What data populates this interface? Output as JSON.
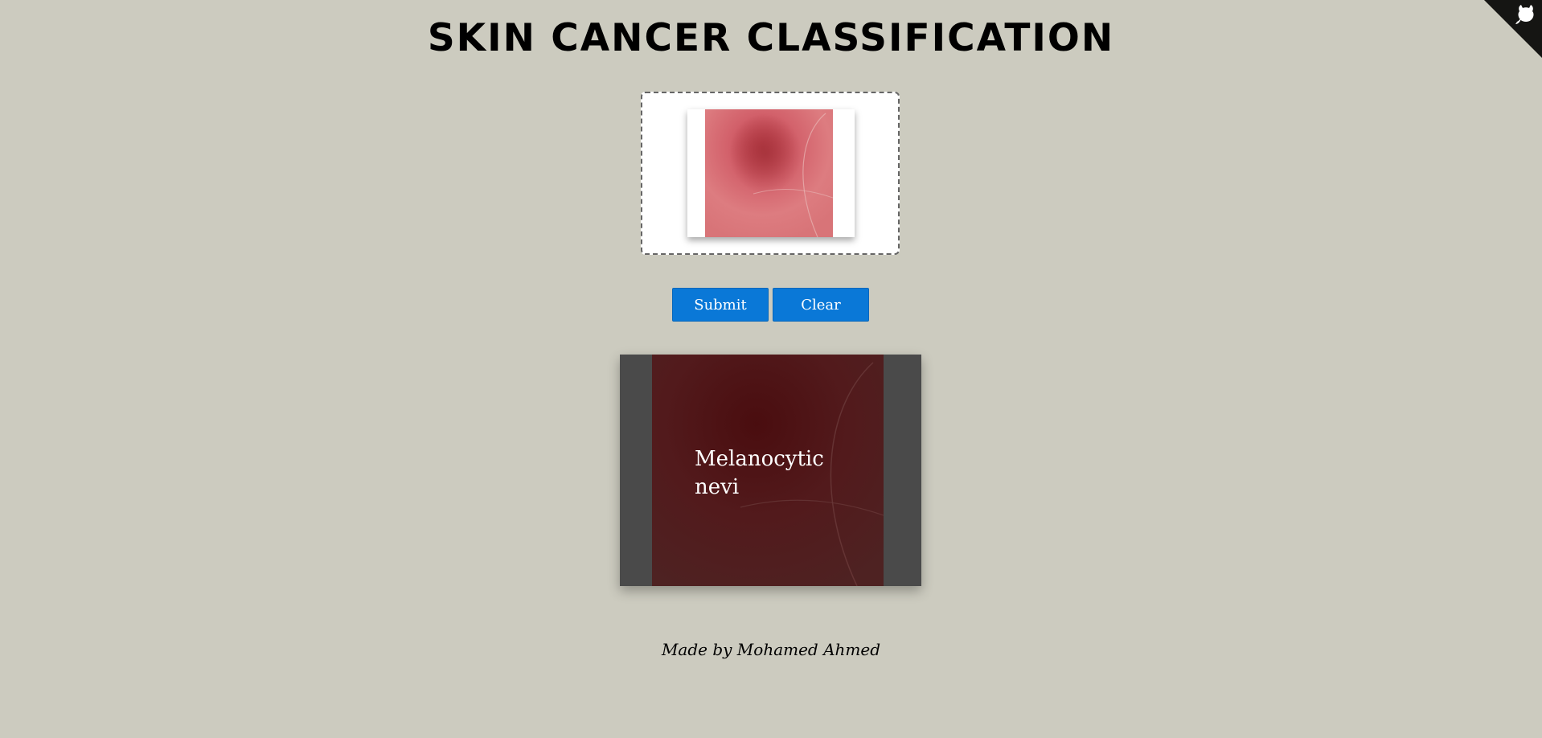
{
  "header": {
    "title": "SKIN CANCER CLASSIFICATION"
  },
  "upload": {
    "preview_icon": "skin-lesion-image"
  },
  "buttons": {
    "submit_label": "Submit",
    "clear_label": "Clear"
  },
  "result": {
    "label_line1": "Melanocytic",
    "label_line2": "nevi"
  },
  "footer": {
    "credit": "Made by Mohamed Ahmed"
  },
  "corner": {
    "icon": "github-cat-icon"
  },
  "colors": {
    "background": "#cccbbf",
    "button": "#0a78d7",
    "result_panel": "#4a4a4a"
  }
}
